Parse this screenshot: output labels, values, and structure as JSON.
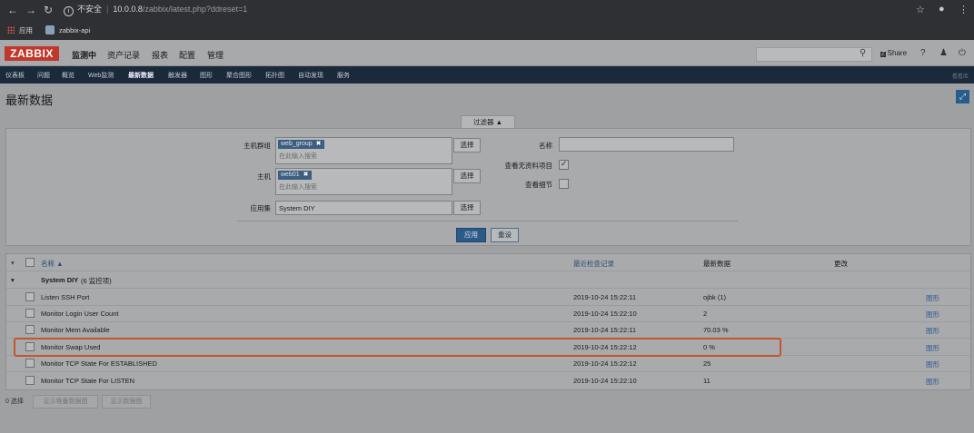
{
  "browser": {
    "security_label": "不安全",
    "url_host": "10.0.0.8",
    "url_path": "/zabbix/latest.php?ddreset=1",
    "bookmarks": [
      "应用",
      "zabbix-api"
    ]
  },
  "header": {
    "logo": "ZABBIX",
    "menu": [
      "监测中",
      "资产记录",
      "报表",
      "配置",
      "管理"
    ],
    "share": "Share"
  },
  "subnav": {
    "items": [
      "仪表板",
      "问题",
      "概览",
      "Web监测",
      "最新数据",
      "触发器",
      "图形",
      "聚合图形",
      "拓扑图",
      "自动发现",
      "服务"
    ],
    "right": "看看库"
  },
  "page": {
    "title": "最新数据"
  },
  "filter": {
    "tab_label": "过滤器 ▲",
    "host_group_label": "主机群组",
    "host_group_tag": "web_group",
    "host_label": "主机",
    "host_tag": "web01",
    "search_placeholder": "在此输入搜索",
    "app_label": "应用集",
    "app_value": "System DIY",
    "select_label": "选择",
    "name_label": "名称",
    "show_no_data_label": "查看无资料项目",
    "show_no_data_checked": true,
    "show_details_label": "查看细节",
    "show_details_checked": false,
    "apply": "应用",
    "reset": "重设"
  },
  "table": {
    "headers": {
      "name": "名称 ▲",
      "last_check": "最近检查记录",
      "last_value": "最新数据",
      "change": "更改"
    },
    "group": {
      "name": "System DIY",
      "count": "(6 监控项)"
    },
    "rows": [
      {
        "name": "Listen SSH Port",
        "last_check": "2019-10-24 15:22:11",
        "last_value": "ojbk (1)",
        "link": "图形"
      },
      {
        "name": "Monitor Login User Count",
        "last_check": "2019-10-24 15:22:10",
        "last_value": "2",
        "link": "图形"
      },
      {
        "name": "Monitor Mem Available",
        "last_check": "2019-10-24 15:22:11",
        "last_value": "70.03 %",
        "link": "图形"
      },
      {
        "name": "Monitor Swap Used",
        "last_check": "2019-10-24 15:22:12",
        "last_value": "0 %",
        "link": "图形"
      },
      {
        "name": "Monitor TCP State For ESTABLISHED",
        "last_check": "2019-10-24 15:22:12",
        "last_value": "25",
        "link": "图形"
      },
      {
        "name": "Monitor TCP State For LISTEN",
        "last_check": "2019-10-24 15:22:10",
        "last_value": "11",
        "link": "图形"
      }
    ]
  },
  "footer": {
    "selected": "0 选择",
    "btn_stacked": "显示堆叠数据图",
    "btn_graph": "显示数据图"
  }
}
